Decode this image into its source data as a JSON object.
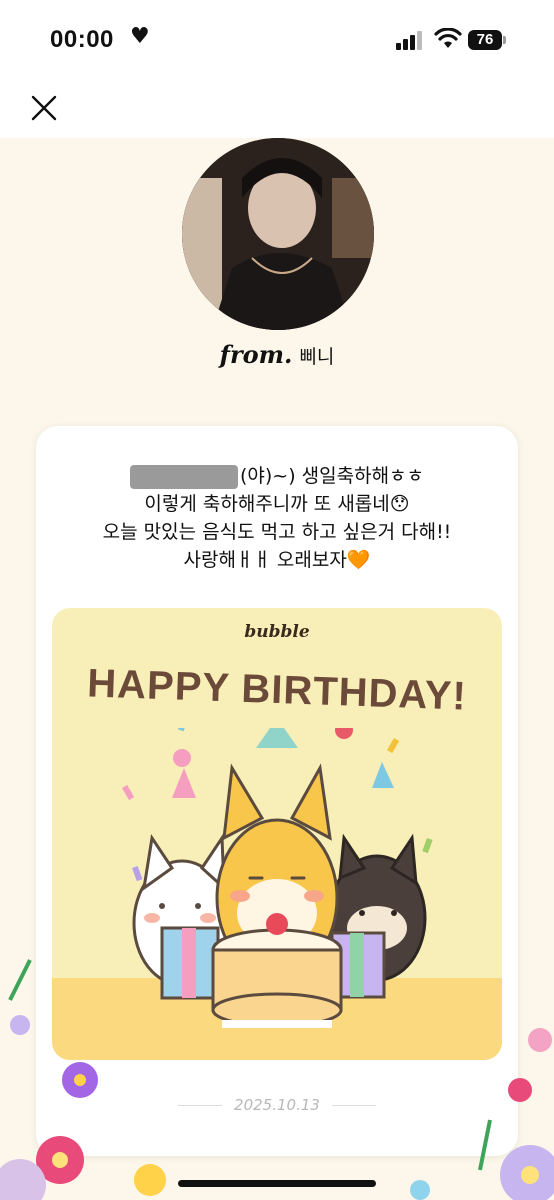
{
  "status": {
    "time": "00:00",
    "battery": "76"
  },
  "header": {
    "close_icon": "close-icon"
  },
  "profile": {
    "from_label": "from.",
    "name": "삐니"
  },
  "message": {
    "lines": [
      "(야)~) 생일축하해ㅎㅎ",
      "이렇게 축하해주니까 또 새롭네😯",
      "오늘 맛있는 음식도 먹고 하고 싶은거 다해!!",
      "사랑해ㅐㅐ 오래보자🧡"
    ]
  },
  "birthday_card": {
    "logo": "bubble",
    "title": "HAPPY BIRTHDAY!"
  },
  "date": "2025.10.13",
  "colors": {
    "background": "#fcf7ea",
    "card": "#ffffff",
    "birthday_bg": "#f8efb8",
    "title": "#6b4a3a"
  }
}
